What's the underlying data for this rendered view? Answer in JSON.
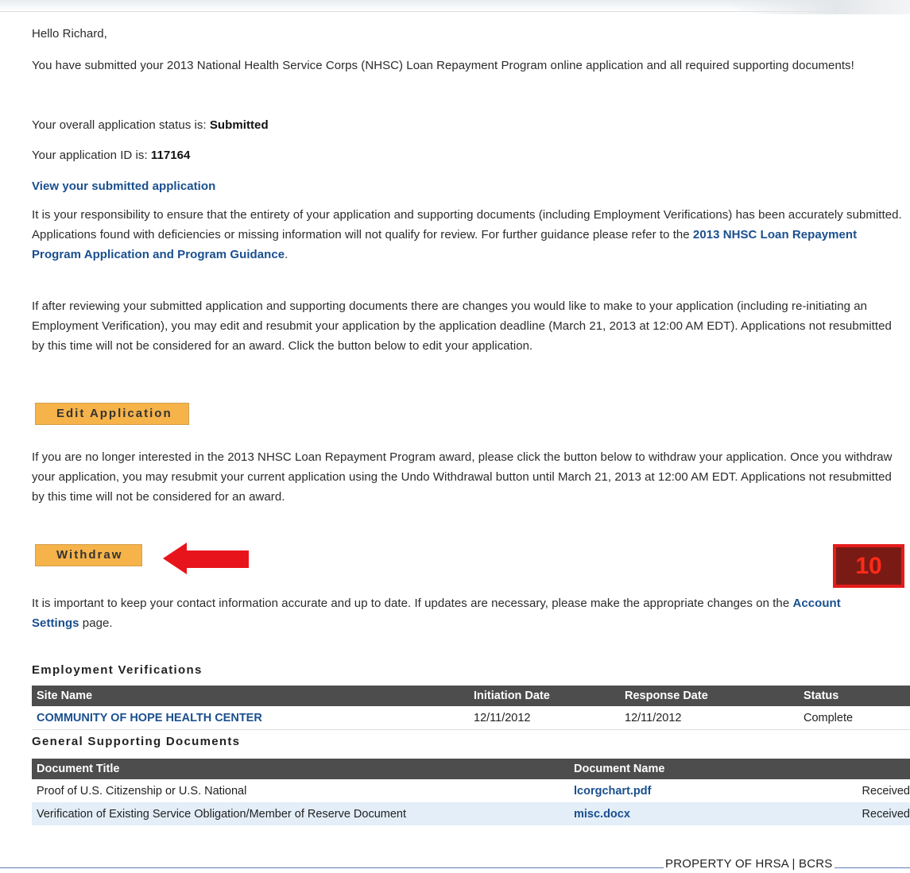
{
  "greeting": "Hello Richard,",
  "intro_text": "You have submitted your 2013 National Health Service Corps (NHSC) Loan Repayment Program online application and all required supporting documents!",
  "status_prefix": "Your overall application status is: ",
  "status_value": "Submitted",
  "app_id_prefix": "Your application ID is: ",
  "app_id_value": "117164",
  "view_link": "View your submitted application",
  "responsibility_text": "It is your responsibility to ensure that the entirety of your application and supporting documents (including Employment Verifications) has been accurately submitted. Applications found with deficiencies or missing information will not qualify for review. For further guidance please refer to the ",
  "guidance_link": "2013 NHSC Loan Repayment Program Application and Program Guidance",
  "guidance_suffix": ".",
  "edit_paragraph": "If after reviewing your submitted application and supporting documents there are changes you would like to make to your application (including re-initiating an Employment Verification), you may edit and resubmit your application by the application deadline (March 21, 2013 at 12:00 AM EDT). Applications not resubmitted by this time will not be considered for an award. Click the button below to edit your application.",
  "edit_button": "Edit Application",
  "withdraw_paragraph": "If you are no longer interested in the 2013 NHSC Loan Repayment Program award, please click the button below to withdraw your application. Once you withdraw your application, you may resubmit your current application using the Undo Withdrawal button until March 21, 2013 at 12:00 AM EDT. Applications not resubmitted by this time will not be considered for an award.",
  "withdraw_button": "Withdraw",
  "contact_text": "It is important to keep your contact information accurate and up to date. If updates are necessary, please make the appropriate changes on the ",
  "account_link": "Account Settings",
  "contact_suffix": " page.",
  "employment": {
    "title": "Employment Verifications",
    "headers": [
      "Site Name",
      "Initiation Date",
      "Response Date",
      "Status"
    ],
    "rows": [
      {
        "site": "COMMUNITY OF HOPE HEALTH CENTER",
        "initiation": "12/11/2012",
        "response": "12/11/2012",
        "status": "Complete"
      }
    ]
  },
  "documents": {
    "title": "General Supporting Documents",
    "headers": [
      "Document Title",
      "Document Name"
    ],
    "rows": [
      {
        "title": "Proof of U.S. Citizenship or U.S. National",
        "name": "lcorgchart.pdf",
        "status": "Received"
      },
      {
        "title": "Verification of Existing Service Obligation/Member of Reserve Document",
        "name": "misc.docx",
        "status": "Received"
      }
    ]
  },
  "badge": "10",
  "footer": "PROPERTY OF HRSA | BCRS",
  "colors": {
    "accent_button": "#f5b34a",
    "link": "#1a4f8f",
    "table_header": "#4d4d4d",
    "arrow": "#e8141b",
    "badge_border": "#e61b1b"
  }
}
